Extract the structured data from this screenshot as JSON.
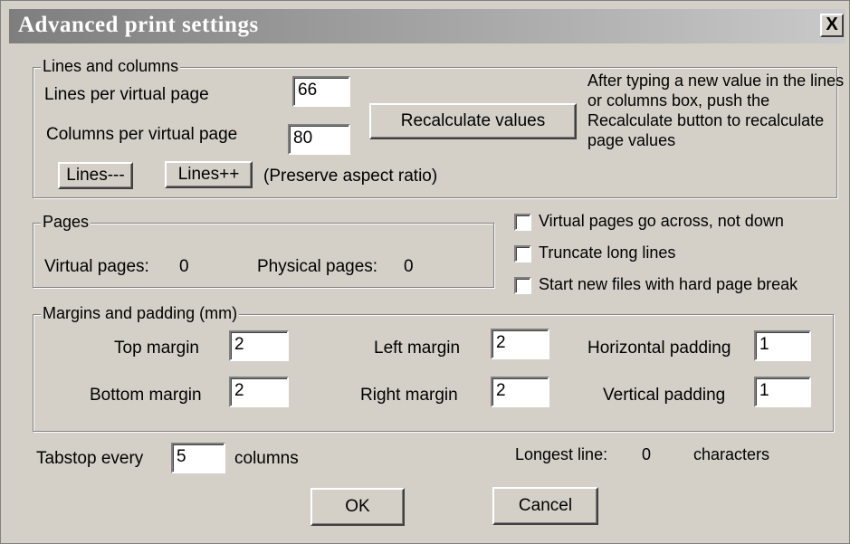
{
  "window": {
    "title": "Advanced print settings",
    "close_glyph": "X"
  },
  "lines_columns": {
    "legend": "Lines and columns",
    "lines_label": "Lines per virtual page",
    "lines_value": "66",
    "columns_label": "Columns per virtual page",
    "columns_value": "80",
    "recalc_label": "Recalculate values",
    "help_text": "After typing a new value in the lines or columns box, push the Recalculate button to recalculate page values",
    "lines_minus_label": "Lines---",
    "lines_plus_label": "Lines++",
    "aspect_note": "(Preserve aspect ratio)"
  },
  "pages": {
    "legend": "Pages",
    "virtual_label": "Virtual pages:",
    "virtual_value": "0",
    "physical_label": "Physical pages:",
    "physical_value": "0"
  },
  "options": [
    {
      "label": "Virtual pages go across, not down",
      "checked": false
    },
    {
      "label": "Truncate long lines",
      "checked": false
    },
    {
      "label": "Start new files with hard page break",
      "checked": false
    }
  ],
  "margins": {
    "legend": "Margins and padding (mm)",
    "top_label": "Top margin",
    "top_value": "2",
    "bottom_label": "Bottom margin",
    "bottom_value": "2",
    "left_label": "Left margin",
    "left_value": "2",
    "right_label": "Right margin",
    "right_value": "2",
    "hpad_label": "Horizontal padding",
    "hpad_value": "1",
    "vpad_label": "Vertical padding",
    "vpad_value": "1"
  },
  "tabstop": {
    "label": "Tabstop every",
    "value": "5",
    "suffix": "columns"
  },
  "longest": {
    "label": "Longest line:",
    "value": "0",
    "suffix": "characters"
  },
  "buttons": {
    "ok": "OK",
    "cancel": "Cancel"
  }
}
